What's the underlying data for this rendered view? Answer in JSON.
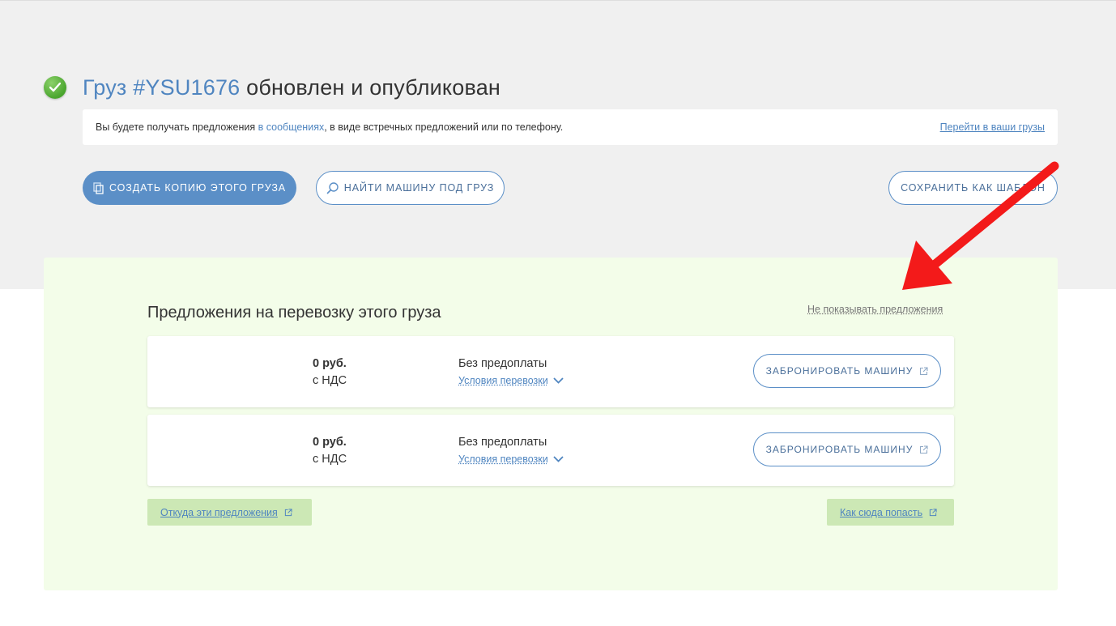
{
  "header": {
    "title_link": "Груз #YSU1676",
    "title_rest": "обновлен и опубликован"
  },
  "notice": {
    "text_before": "Вы будете получать предложения",
    "link_messages": "в сообщениях",
    "text_after": ", в виде встречных предложений или по телефону.",
    "right_link": "Перейти в ваши грузы"
  },
  "actions": {
    "copy_label": "Создать копию этого груза",
    "find_label": "Найти машину под груз",
    "template_label": "Сохранить как шаблон"
  },
  "offers": {
    "heading": "Предложения на перевозку этого груза",
    "hide_link": "Не показывать предложения",
    "items": [
      {
        "amount": "0 руб.",
        "vat": "с НДС",
        "payment": "Без предоплаты",
        "conditions": "Условия перевозки",
        "book_label": "Забронировать машину"
      },
      {
        "amount": "0 руб.",
        "vat": "с НДС",
        "payment": "Без предоплаты",
        "conditions": "Условия перевозки",
        "book_label": "Забронировать машину"
      }
    ],
    "source_link": "Откуда эти предложения",
    "howto_link": "Как сюда попасть"
  },
  "colors": {
    "accent": "#5b8fc7",
    "link": "#4f85c0",
    "panel_bg": "#f3fde9",
    "chip_bg": "#cce8b5",
    "arrow": "#f31a1a"
  },
  "icons": [
    "check-circle-icon",
    "copy-icon",
    "search-icon",
    "external-link-icon",
    "chevron-down-icon"
  ]
}
